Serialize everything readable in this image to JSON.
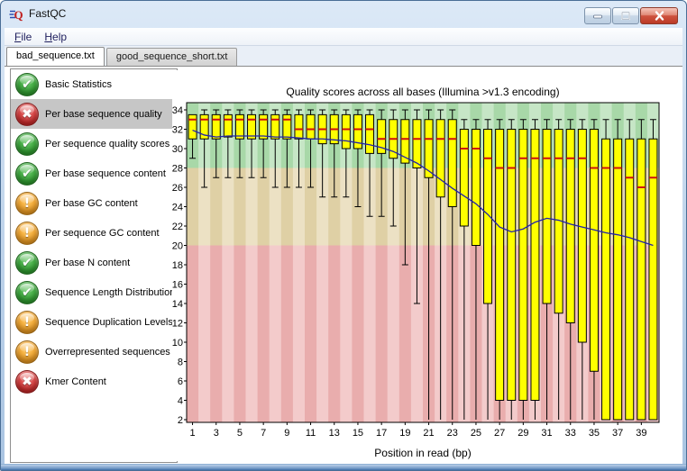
{
  "window": {
    "title": "FastQC",
    "controls": [
      {
        "name": "minimize"
      },
      {
        "name": "maximize"
      },
      {
        "name": "close"
      }
    ]
  },
  "menu": {
    "items": [
      {
        "label": "File",
        "accelerator": "F"
      },
      {
        "label": "Help",
        "accelerator": "H"
      }
    ]
  },
  "tabs": [
    {
      "label": "bad_sequence.txt",
      "active": true
    },
    {
      "label": "good_sequence_short.txt",
      "active": false
    }
  ],
  "sidebar": {
    "status_glyphs": {
      "pass": "✔",
      "fail": "✖",
      "warn": "!"
    },
    "status_colors": {
      "pass": "#2f9e2f",
      "fail": "#ce2b2b",
      "warn": "#ef9d22"
    },
    "items": [
      {
        "label": "Basic Statistics",
        "status": "pass",
        "selected": false
      },
      {
        "label": "Per base sequence quality",
        "status": "fail",
        "selected": true
      },
      {
        "label": "Per sequence quality scores",
        "status": "pass",
        "selected": false
      },
      {
        "label": "Per base sequence content",
        "status": "pass",
        "selected": false
      },
      {
        "label": "Per base GC content",
        "status": "warn",
        "selected": false
      },
      {
        "label": "Per sequence GC content",
        "status": "warn",
        "selected": false
      },
      {
        "label": "Per base N content",
        "status": "pass",
        "selected": false
      },
      {
        "label": "Sequence Length Distribution",
        "status": "pass",
        "selected": false
      },
      {
        "label": "Sequence Duplication Levels",
        "status": "warn",
        "selected": false
      },
      {
        "label": "Overrepresented sequences",
        "status": "warn",
        "selected": false
      },
      {
        "label": "Kmer Content",
        "status": "fail",
        "selected": false
      }
    ]
  },
  "chart_data": {
    "type": "boxplot",
    "title": "Quality scores across all bases (Illumina >v1.3 encoding)",
    "xlabel": "Position in read (bp)",
    "ylim": [
      2,
      34
    ],
    "y_tick_labels": [
      2,
      4,
      6,
      8,
      10,
      12,
      14,
      16,
      18,
      20,
      22,
      24,
      26,
      28,
      30,
      32,
      34
    ],
    "x_tick_labels": [
      1,
      3,
      5,
      7,
      9,
      11,
      13,
      15,
      17,
      19,
      21,
      23,
      25,
      27,
      29,
      31,
      33,
      35,
      37,
      39
    ],
    "positions": [
      1,
      2,
      3,
      4,
      5,
      6,
      7,
      8,
      9,
      10,
      11,
      12,
      13,
      14,
      15,
      16,
      17,
      18,
      19,
      20,
      21,
      22,
      23,
      24,
      25,
      26,
      27,
      28,
      29,
      30,
      31,
      32,
      33,
      34,
      35,
      36,
      37,
      38,
      39,
      40
    ],
    "grid": false,
    "legend": "none",
    "box_columns": [
      "whisker_low",
      "q1",
      "median",
      "q3",
      "whisker_high"
    ],
    "boxes": [
      [
        29,
        31,
        33,
        33.5,
        33.5
      ],
      [
        26,
        31,
        33,
        33.5,
        34
      ],
      [
        27,
        31,
        33,
        33.5,
        34
      ],
      [
        27,
        31.2,
        33,
        33.5,
        34
      ],
      [
        27,
        31,
        33,
        33.5,
        34
      ],
      [
        27,
        31,
        33,
        33.5,
        34
      ],
      [
        27,
        31,
        33,
        33.5,
        34
      ],
      [
        26,
        31,
        33,
        33.5,
        34
      ],
      [
        26,
        31,
        33,
        33.5,
        34
      ],
      [
        26,
        31,
        32,
        33.5,
        34
      ],
      [
        26,
        31,
        32,
        33.5,
        34
      ],
      [
        25,
        30.5,
        32,
        33.5,
        34
      ],
      [
        25,
        30.5,
        32,
        33.5,
        34
      ],
      [
        25,
        30,
        32,
        33.5,
        34
      ],
      [
        24,
        30,
        32,
        33.5,
        34
      ],
      [
        23,
        29.5,
        32,
        33.5,
        34
      ],
      [
        23,
        29.5,
        31,
        33,
        34
      ],
      [
        22,
        29,
        31,
        33,
        34
      ],
      [
        18,
        28.5,
        31,
        33,
        34
      ],
      [
        14,
        28,
        31,
        33,
        34
      ],
      [
        2,
        27,
        31,
        33,
        34
      ],
      [
        2,
        25,
        31,
        33,
        34
      ],
      [
        2,
        24,
        31,
        33,
        34
      ],
      [
        2,
        22,
        30,
        32,
        33
      ],
      [
        2,
        20,
        30,
        32,
        33
      ],
      [
        2,
        14,
        29,
        32,
        33
      ],
      [
        2,
        4,
        28,
        32,
        33
      ],
      [
        2,
        4,
        28,
        32,
        33
      ],
      [
        2,
        4,
        29,
        32,
        33
      ],
      [
        2,
        4,
        29,
        32,
        33
      ],
      [
        2,
        14,
        29,
        32,
        33
      ],
      [
        2,
        13,
        29,
        32,
        33
      ],
      [
        2,
        12,
        29,
        32,
        33
      ],
      [
        2,
        10,
        29,
        32,
        33
      ],
      [
        2,
        7,
        28,
        32,
        33
      ],
      [
        2,
        2,
        28,
        31,
        33
      ],
      [
        2,
        2,
        28,
        31,
        33
      ],
      [
        2,
        2,
        27,
        31,
        33
      ],
      [
        2,
        2,
        26,
        31,
        33
      ],
      [
        2,
        2,
        27,
        31,
        33
      ]
    ],
    "mean_series": {
      "name": "mean quality",
      "color": "#2222aa",
      "values": [
        31.9,
        31.4,
        31.2,
        31.3,
        31.3,
        31.3,
        31.3,
        31.2,
        31.2,
        31.1,
        31.0,
        31.0,
        30.9,
        30.8,
        30.6,
        30.4,
        30.1,
        29.7,
        29.1,
        28.5,
        27.7,
        26.8,
        25.9,
        25.1,
        24.3,
        23.2,
        21.9,
        21.4,
        21.7,
        22.4,
        22.8,
        22.6,
        22.2,
        21.9,
        21.6,
        21.3,
        21.1,
        20.8,
        20.4,
        20.0
      ]
    },
    "box_fill": "#ffff00",
    "box_stroke": "#000000",
    "median_color": "#cc1111",
    "zones": [
      {
        "name": "poor-quality",
        "from": null,
        "to": 20,
        "colors": [
          "#e9adad",
          "#f3cbcb"
        ]
      },
      {
        "name": "ok-quality",
        "from": 20,
        "to": 28,
        "colors": [
          "#dfd0a5",
          "#ece1c4"
        ]
      },
      {
        "name": "good-quality",
        "from": 28,
        "to": null,
        "colors": [
          "#a8d8a8",
          "#c6e6c6"
        ]
      }
    ]
  }
}
